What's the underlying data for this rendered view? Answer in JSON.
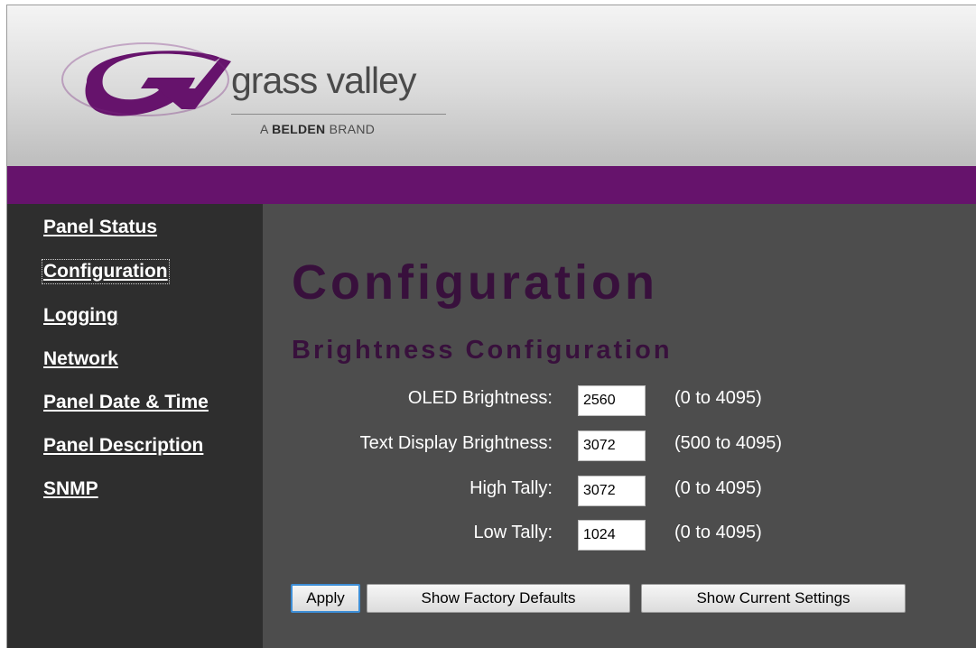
{
  "brand": {
    "name": "grass valley",
    "tagline_prefix": "A",
    "tagline_bold": "BELDEN",
    "tagline_suffix": "BRAND",
    "colors": {
      "purple": "#66136c",
      "title": "#38103c",
      "accent_button": "#3d8ed6"
    }
  },
  "sidebar": {
    "items": [
      {
        "label": "Panel Status"
      },
      {
        "label": "Configuration"
      },
      {
        "label": "Logging"
      },
      {
        "label": "Network"
      },
      {
        "label": "Panel Date & Time"
      },
      {
        "label": "Panel Description"
      },
      {
        "label": "SNMP"
      }
    ]
  },
  "main": {
    "title": "Configuration",
    "section_title": "Brightness Configuration",
    "fields": [
      {
        "label": "OLED Brightness:",
        "value": "2560",
        "range": "(0 to 4095)"
      },
      {
        "label": "Text Display Brightness:",
        "value": "3072",
        "range": "(500 to 4095)"
      },
      {
        "label": "High Tally:",
        "value": "3072",
        "range": "(0 to 4095)"
      },
      {
        "label": "Low Tally:",
        "value": "1024",
        "range": "(0 to 4095)"
      }
    ],
    "buttons": {
      "apply": "Apply",
      "factory_defaults": "Show Factory Defaults",
      "current_settings": "Show Current Settings"
    }
  }
}
